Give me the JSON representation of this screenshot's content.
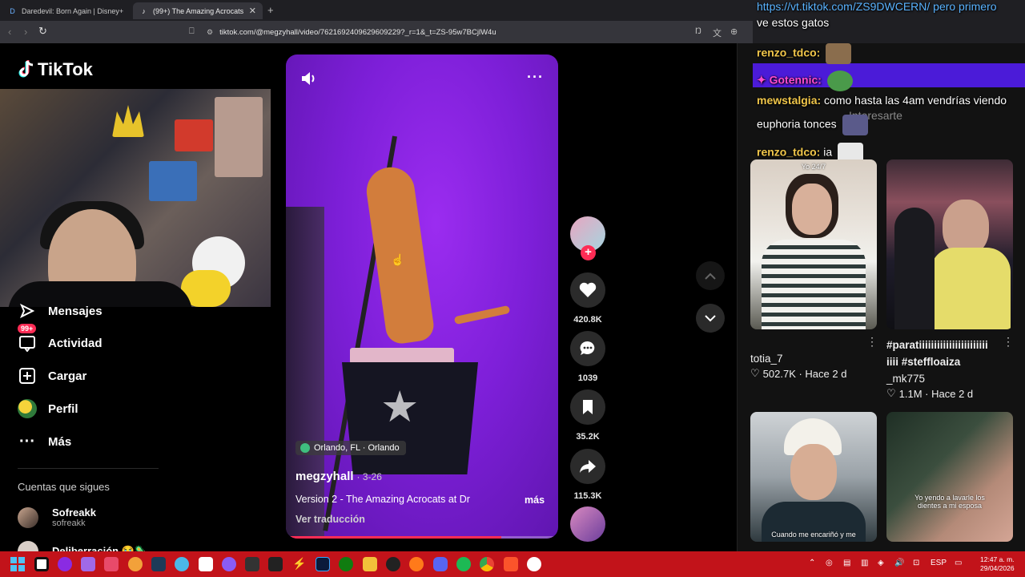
{
  "browser": {
    "tabs": [
      {
        "label": "Daredevil: Born Again | Disney+",
        "active": false
      },
      {
        "label": "(99+) The Amazing Acrocats at Dr",
        "active": true
      }
    ],
    "new_tab": "+",
    "url": "tiktok.com/@megzyhall/video/7621692409629609229?_r=1&_t=ZS-95w7BCjlW4u"
  },
  "brand": {
    "name": "TikTok"
  },
  "nav": {
    "items": [
      {
        "label": "Mensajes",
        "icon": "send-icon"
      },
      {
        "label": "Actividad",
        "icon": "inbox-icon",
        "badge": "99+"
      },
      {
        "label": "Cargar",
        "icon": "upload-icon"
      },
      {
        "label": "Perfil",
        "icon": "profile-icon"
      },
      {
        "label": "Más",
        "icon": "more-icon"
      }
    ],
    "following_header": "Cuentas que sigues",
    "following": [
      {
        "name": "Sofreakk",
        "handle": "sofreakk"
      },
      {
        "name": "Deliberración 😭🦠...",
        "handle": ""
      }
    ]
  },
  "video": {
    "location": "Orlando, FL · Orlando",
    "author": "megzyhall",
    "date": "· 3-26",
    "description": "Version 2 - The Amazing Acrocats at Dr",
    "more": "más",
    "translate": "Ver traducción",
    "progress": 0.79
  },
  "actions": {
    "likes": "420.8K",
    "comments": "1039",
    "saves": "35.2K",
    "shares": "115.3K"
  },
  "chat": {
    "lines": [
      {
        "user": "",
        "text": "https://vt.tiktok.com/ZS9DWCERN/ pero primero"
      },
      {
        "user": "",
        "text": "ve estos gatos"
      },
      {
        "user": "renzo_tdco:",
        "text": ""
      },
      {
        "user": "✦ Gotennic:",
        "text": ""
      },
      {
        "user": "mewstalgia:",
        "text": "como hasta las 4am vendrías viendo"
      },
      {
        "user": "",
        "text": "euphoria tonces"
      },
      {
        "user": "renzo_tdco:",
        "text": "ia"
      }
    ],
    "ghost": "Interesarte",
    "colors": {
      "link": "#5ab3ff",
      "user_gold": "#f0c64a",
      "user_sub": "#ff4ad0",
      "sub_bar": "#4b1bd8"
    }
  },
  "cards": [
    {
      "caption": "Yo 24/7",
      "title": "totia_7",
      "likes": "502.7K",
      "age": "Hace 2 d"
    },
    {
      "caption": "",
      "title": "#paratiiiiiiiiiiiiiiiiiiiiiii iiii #steffloaiza",
      "author": "_mk775",
      "likes": "1.1M",
      "age": "Hace 2 d"
    },
    {
      "caption": "Cuando me encariñó y me",
      "title": ""
    },
    {
      "caption": "Yo yendo a lavarle los dientes a mi esposa",
      "title": ""
    }
  ],
  "taskbar": {
    "lang": "ESP",
    "time": "12:47 a. m.",
    "date": "29/04/2026",
    "colors": {
      "bar": "#c2131a"
    }
  }
}
